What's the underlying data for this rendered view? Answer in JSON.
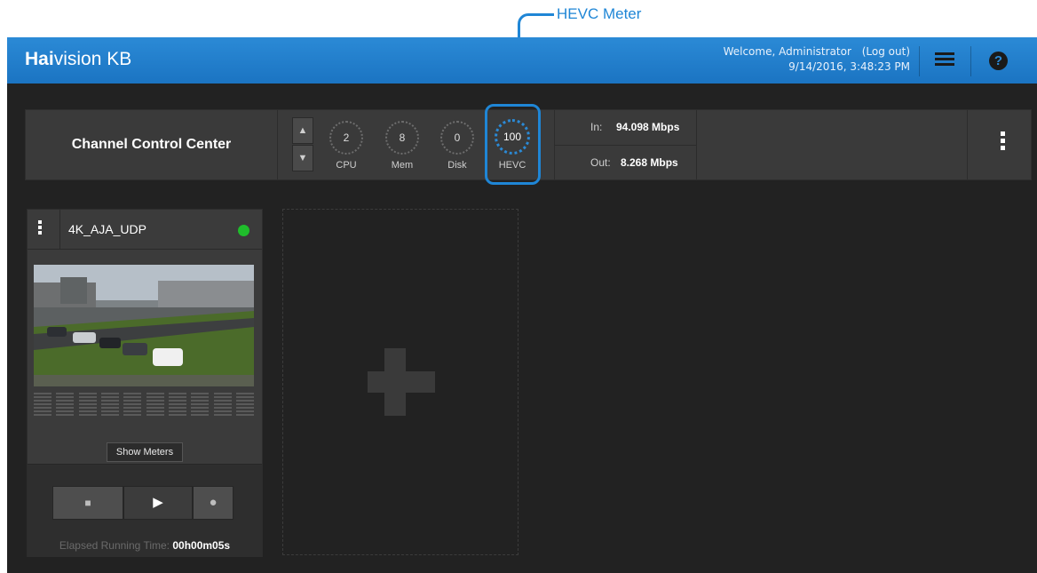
{
  "callout": {
    "label": "HEVC Meter",
    "color": "#1f86d6"
  },
  "header": {
    "brand_bold": "Hai",
    "brand_rest": "vision KB",
    "welcome": "Welcome, Administrator",
    "logout": "(Log out)",
    "datetime": "9/14/2016, 3:48:23 PM",
    "menu_icon": "hamburger-icon",
    "help_icon": "help-icon",
    "help_glyph": "?",
    "color": "#1b74c2"
  },
  "control_center": {
    "title": "Channel Control Center",
    "up_glyph": "▲",
    "down_glyph": "▼",
    "gauges": [
      {
        "label": "CPU",
        "value": "2"
      },
      {
        "label": "Mem",
        "value": "8"
      },
      {
        "label": "Disk",
        "value": "0"
      },
      {
        "label": "HEVC",
        "value": "100"
      }
    ],
    "in_label": "In:",
    "in_value": "94.098 Mbps",
    "out_label": "Out:",
    "out_value": "8.268 Mbps"
  },
  "channel": {
    "name": "4K_AJA_UDP",
    "status_color": "#1fbd2b",
    "show_meters_label": "Show Meters",
    "stop_glyph": "■",
    "play_glyph": "▶",
    "record_glyph": "●",
    "elapsed_label": "Elapsed Running Time:",
    "elapsed_value": "00h00m05s"
  },
  "add_channel": {
    "icon": "plus-icon"
  }
}
